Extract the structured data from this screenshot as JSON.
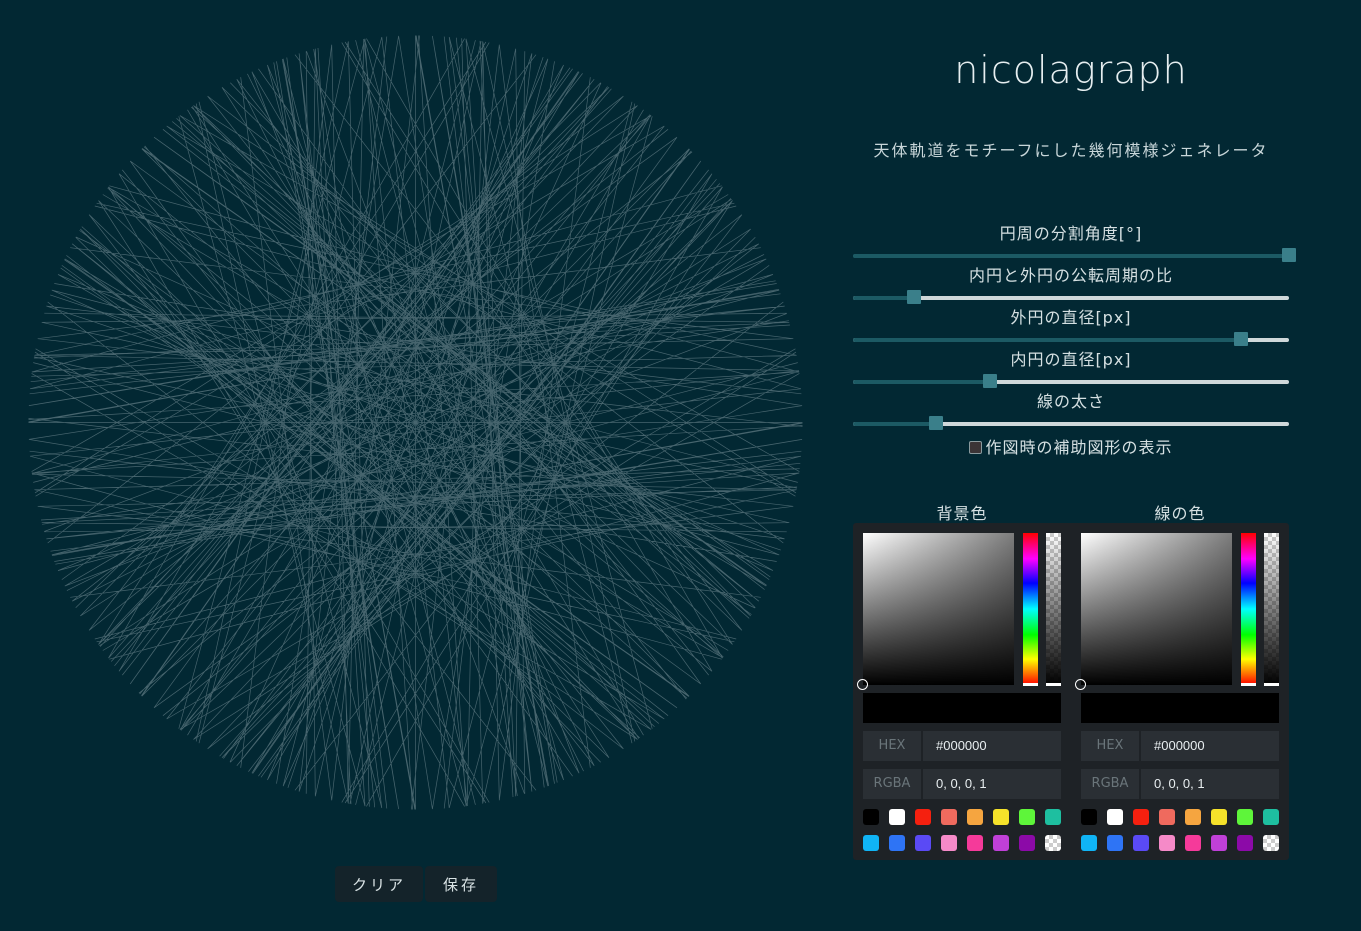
{
  "app": {
    "title": "nicolagraph",
    "subtitle": "天体軌道をモチーフにした幾何模様ジェネレータ"
  },
  "canvas": {
    "background_color": "#022833",
    "line_color": "#c8d8dc"
  },
  "buttons": {
    "clear_label": "クリア",
    "save_label": "保存"
  },
  "sliders": [
    {
      "label": "円周の分割角度[°]",
      "value_fraction": 1.0
    },
    {
      "label": "内円と外円の公転周期の比",
      "value_fraction": 0.14
    },
    {
      "label": "外円の直径[px]",
      "value_fraction": 0.89
    },
    {
      "label": "内円の直径[px]",
      "value_fraction": 0.315
    },
    {
      "label": "線の太さ",
      "value_fraction": 0.19
    }
  ],
  "checkbox": {
    "label": "作図時の補助図形の表示",
    "checked": false
  },
  "pickers": [
    {
      "label": "背景色",
      "hex_label": "HEX",
      "hex_value": "#000000",
      "rgba_label": "RGBA",
      "rgba_value": "0, 0, 0, 1"
    },
    {
      "label": "線の色",
      "hex_label": "HEX",
      "hex_value": "#000000",
      "rgba_label": "RGBA",
      "rgba_value": "0, 0, 0, 1"
    }
  ],
  "swatch_colors": [
    "#000000",
    "#ffffff",
    "#f5200f",
    "#ef6a5e",
    "#f5a540",
    "#f5e22a",
    "#5ef53a",
    "#1ebfa0",
    "#10b4f5",
    "#2e74f5",
    "#5a4af5",
    "#f58ac8",
    "#f53a9a",
    "#c040d8",
    "#8c0aa8",
    "transparent"
  ]
}
